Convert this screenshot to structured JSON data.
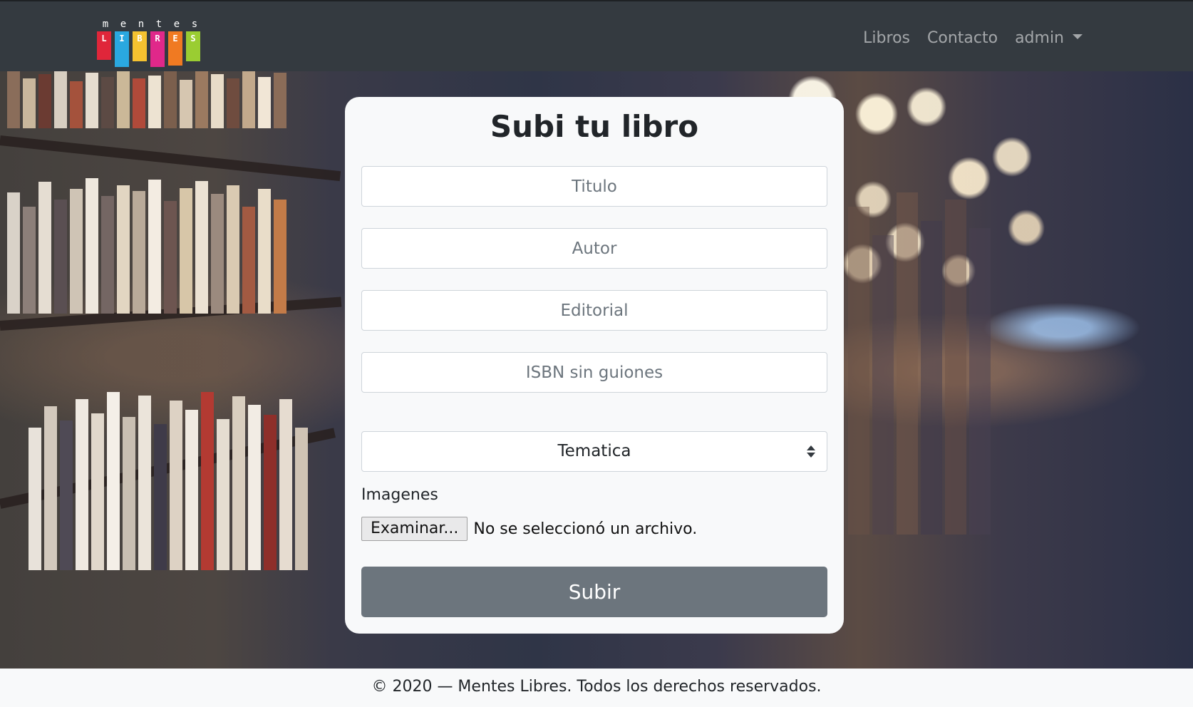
{
  "brand": {
    "logo_top": [
      "m",
      "e",
      "n",
      "t",
      "e",
      "s"
    ],
    "logo_blocks": [
      {
        "letter": "L",
        "color": "#e0263a"
      },
      {
        "letter": "I",
        "color": "#2aa8e0"
      },
      {
        "letter": "B",
        "color": "#f5c230"
      },
      {
        "letter": "R",
        "color": "#e0288a"
      },
      {
        "letter": "E",
        "color": "#f07a22"
      },
      {
        "letter": "S",
        "color": "#9acd32"
      }
    ]
  },
  "nav": {
    "items": [
      "Libros",
      "Contacto"
    ],
    "user_menu": "admin"
  },
  "form": {
    "title": "Subi tu libro",
    "titulo_placeholder": "Titulo",
    "autor_placeholder": "Autor",
    "editorial_placeholder": "Editorial",
    "isbn_placeholder": "ISBN sin guiones",
    "tematica_selected": "Tematica",
    "imagenes_label": "Imagenes",
    "file_button": "Examinar...",
    "file_status": "No se seleccionó un archivo.",
    "submit_label": "Subir"
  },
  "footer": {
    "text": "© 2020 — Mentes Libres. Todos los derechos reservados."
  },
  "colors": {
    "navbar": "#343a40",
    "submit": "#6c757d",
    "card": "#f8f9fa"
  }
}
